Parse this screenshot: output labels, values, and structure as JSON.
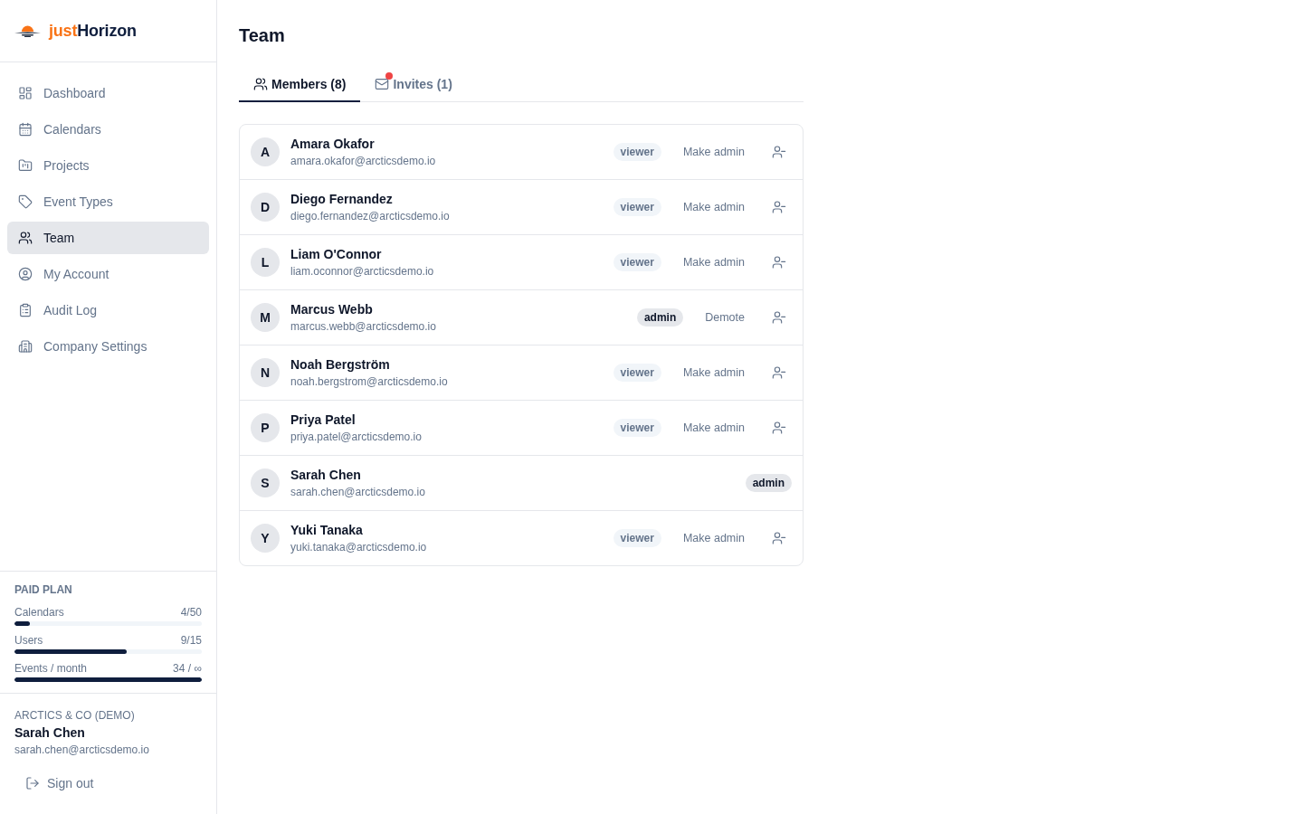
{
  "sidebar": {
    "logo": {
      "accent": "just",
      "name": "Horizon"
    },
    "nav": [
      {
        "label": "Dashboard",
        "selected": false
      },
      {
        "label": "Calendars",
        "selected": false
      },
      {
        "label": "Projects",
        "selected": false
      },
      {
        "label": "Event Types",
        "selected": false
      },
      {
        "label": "Team",
        "selected": true
      },
      {
        "label": "My Account",
        "selected": false
      },
      {
        "label": "Audit Log",
        "selected": false
      },
      {
        "label": "Company Settings",
        "selected": false
      }
    ],
    "plan": {
      "title": "PAID PLAN",
      "meters": [
        {
          "label": "Calendars",
          "reading": "4/50",
          "level": 0.08
        },
        {
          "label": "Users",
          "reading": "9/15",
          "level": 0.6
        },
        {
          "label": "Events / month",
          "reading": "34 / ∞",
          "level": 1
        }
      ]
    },
    "account": {
      "organization": "ARCTICS & CO (DEMO)",
      "name": "Sarah Chen",
      "email": "sarah.chen@arcticsdemo.io",
      "sign_out": "Sign out"
    }
  },
  "page": {
    "title": "Team"
  },
  "tabs": [
    {
      "label": "Members (8)",
      "selected": true,
      "notification": false
    },
    {
      "label": "Invites (1)",
      "selected": false,
      "notification": true
    }
  ],
  "members": [
    {
      "initial": "A",
      "name": "Amara Okafor",
      "email": "amara.okafor@arcticsdemo.io",
      "role": {
        "label": "viewer",
        "kind": "viewer"
      },
      "action": "Make admin",
      "removable": true
    },
    {
      "initial": "D",
      "name": "Diego Fernandez",
      "email": "diego.fernandez@arcticsdemo.io",
      "role": {
        "label": "viewer",
        "kind": "viewer"
      },
      "action": "Make admin",
      "removable": true
    },
    {
      "initial": "L",
      "name": "Liam O'Connor",
      "email": "liam.oconnor@arcticsdemo.io",
      "role": {
        "label": "viewer",
        "kind": "viewer"
      },
      "action": "Make admin",
      "removable": true
    },
    {
      "initial": "M",
      "name": "Marcus Webb",
      "email": "marcus.webb@arcticsdemo.io",
      "role": {
        "label": "admin",
        "kind": "admin"
      },
      "action": "Demote",
      "removable": true
    },
    {
      "initial": "N",
      "name": "Noah Bergström",
      "email": "noah.bergstrom@arcticsdemo.io",
      "role": {
        "label": "viewer",
        "kind": "viewer"
      },
      "action": "Make admin",
      "removable": true
    },
    {
      "initial": "P",
      "name": "Priya Patel",
      "email": "priya.patel@arcticsdemo.io",
      "role": {
        "label": "viewer",
        "kind": "viewer"
      },
      "action": "Make admin",
      "removable": true
    },
    {
      "initial": "S",
      "name": "Sarah Chen",
      "email": "sarah.chen@arcticsdemo.io",
      "role": {
        "label": "admin",
        "kind": "admin"
      },
      "removable": false
    },
    {
      "initial": "Y",
      "name": "Yuki Tanaka",
      "email": "yuki.tanaka@arcticsdemo.io",
      "role": {
        "label": "viewer",
        "kind": "viewer"
      },
      "action": "Make admin",
      "removable": true
    }
  ]
}
